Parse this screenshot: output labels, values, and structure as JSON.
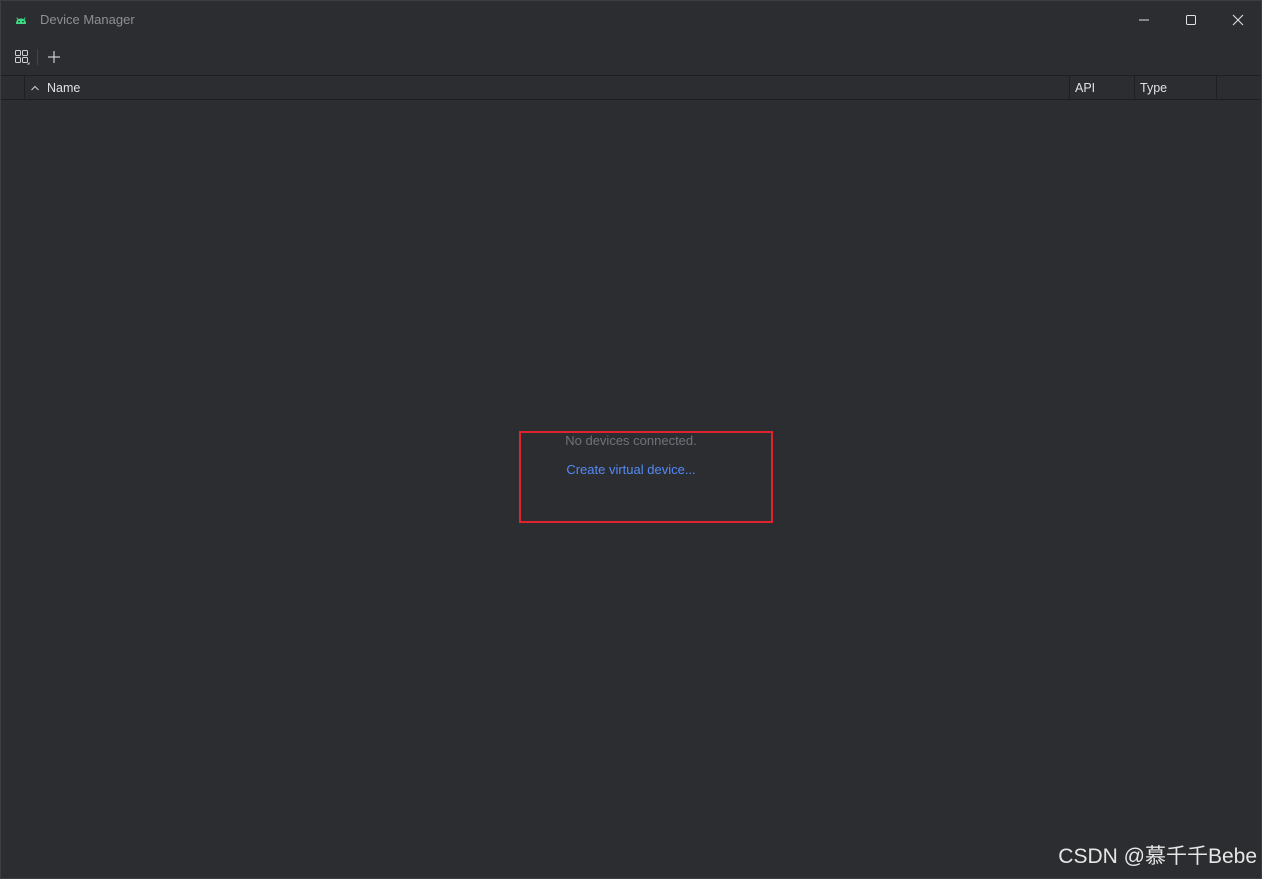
{
  "window": {
    "title": "Device Manager",
    "icon": "android-icon",
    "controls": {
      "minimize": "minimize-icon",
      "maximize": "maximize-icon",
      "close": "close-icon"
    }
  },
  "toolbar": {
    "buttons": [
      {
        "icon": "layout-grid-icon"
      },
      {
        "icon": "plus-icon"
      }
    ]
  },
  "table": {
    "columns": {
      "name": "Name",
      "api": "API",
      "type": "Type"
    },
    "sort": {
      "column": "Name",
      "direction": "ascending"
    },
    "rows": []
  },
  "empty_state": {
    "message": "No devices connected.",
    "link": "Create virtual device..."
  },
  "annotation": {
    "color": "#e0242f"
  },
  "watermark": {
    "text": "CSDN @慕千千Bebe"
  },
  "colors": {
    "background": "#2b2d30",
    "link": "#548af7",
    "muted_text": "#6f737a",
    "android_green": "#3ddc84"
  }
}
